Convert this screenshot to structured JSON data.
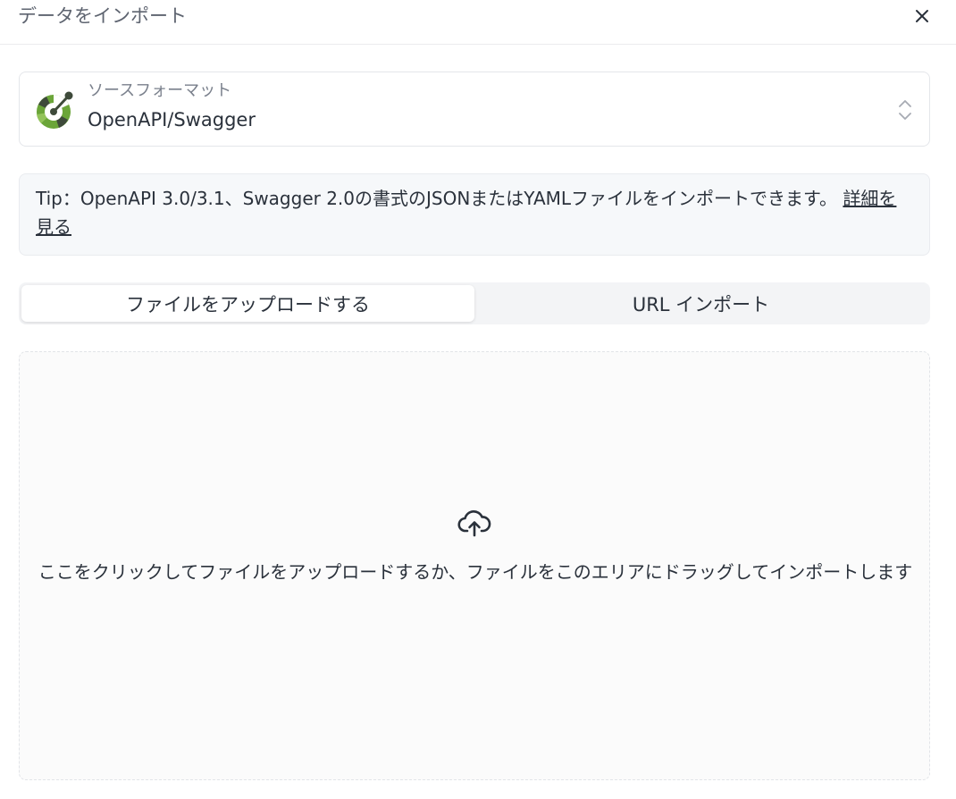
{
  "dialog": {
    "title": "データをインポート"
  },
  "source_format": {
    "label": "ソースフォーマット",
    "value": "OpenAPI/Swagger",
    "logo_icon": "openapi-logo-icon",
    "logo_color": "#6ba539"
  },
  "tip": {
    "text": "Tip：OpenAPI 3.0/3.1、Swagger 2.0の書式のJSONまたはYAMLファイルをインポートできます。 ",
    "link_label": "詳細を見る"
  },
  "tabs": [
    {
      "label": "ファイルをアップロードする",
      "active": true
    },
    {
      "label": "URL インポート",
      "active": false
    }
  ],
  "dropzone": {
    "icon": "cloud-upload-icon",
    "text": "ここをクリックしてファイルをアップロードするか、ファイルをこのエリアにドラッグしてインポートします"
  }
}
